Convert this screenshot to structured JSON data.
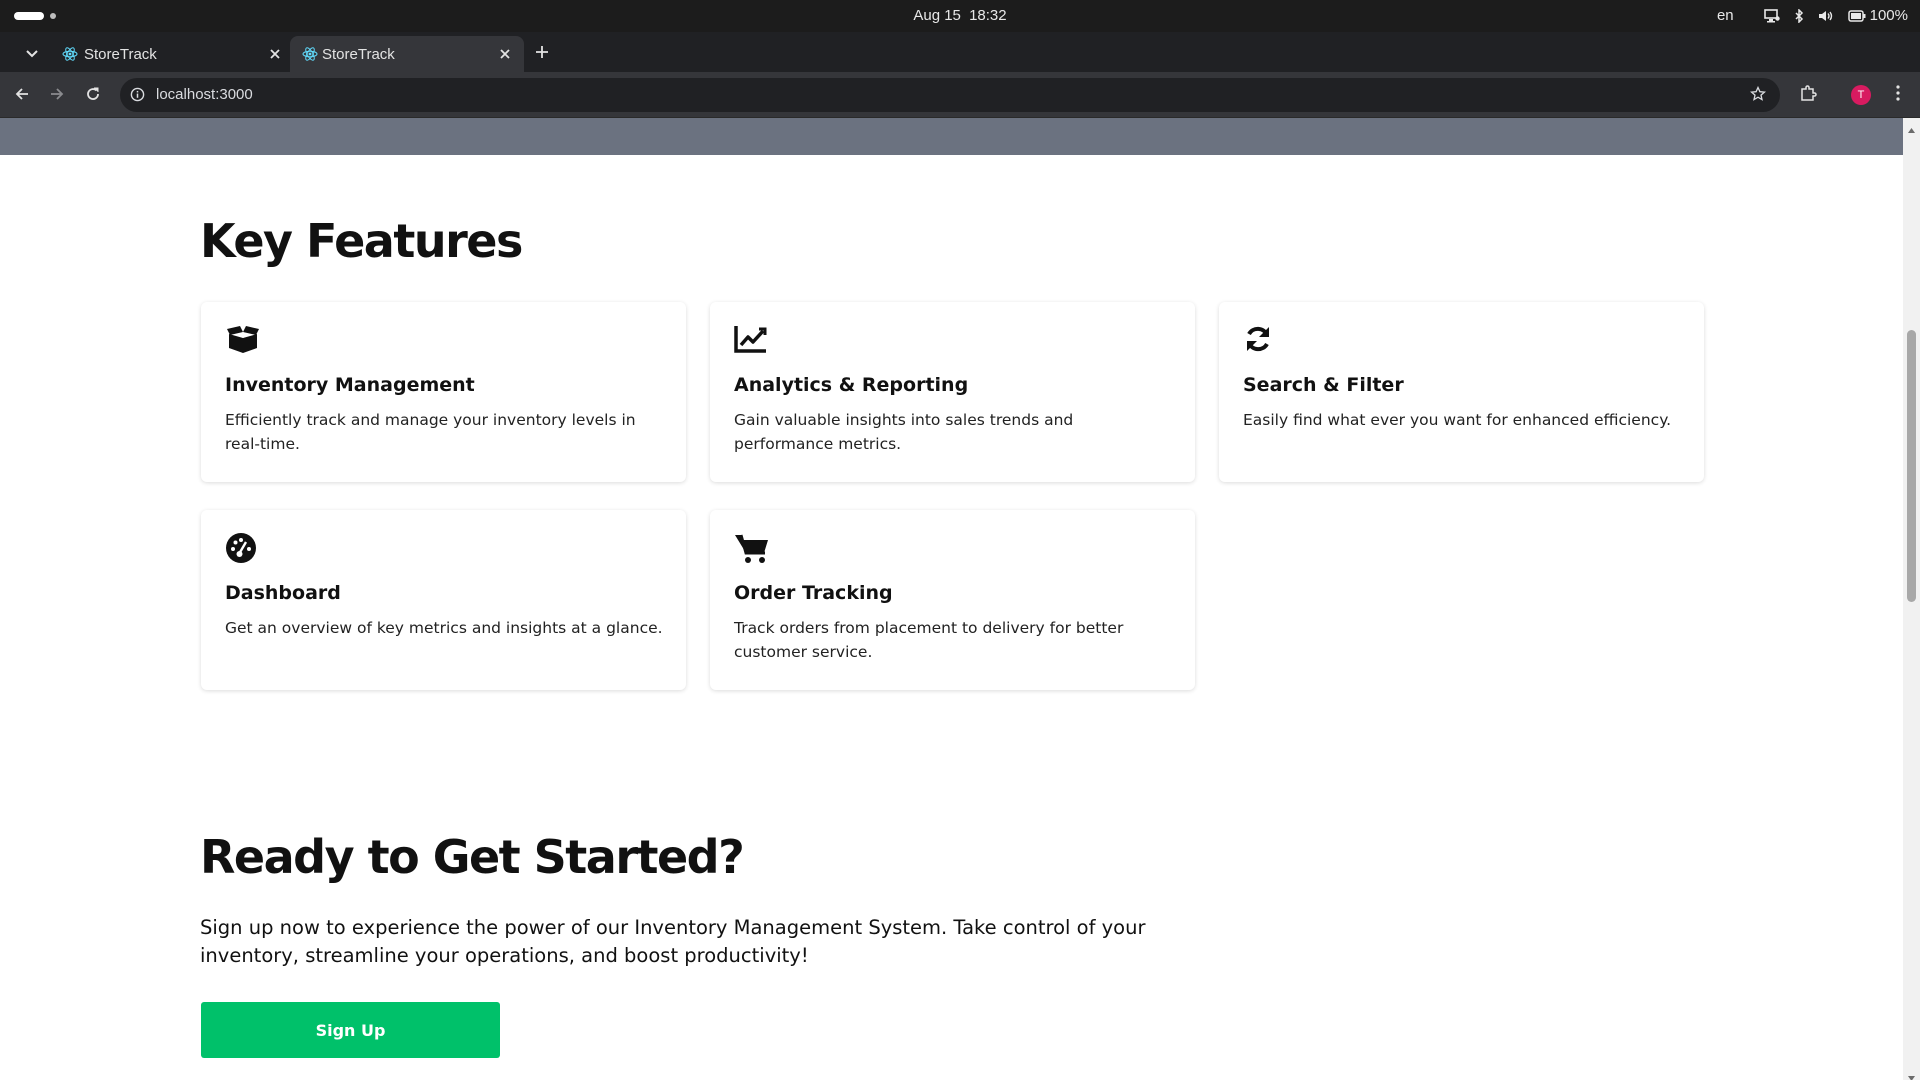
{
  "os": {
    "date": "Aug 15",
    "time": "18:32",
    "language": "en",
    "battery": "100%",
    "icons": [
      "display-icon",
      "bluetooth-icon",
      "volume-icon",
      "battery-icon"
    ]
  },
  "browser": {
    "tabs": [
      {
        "title": "StoreTrack",
        "active": false,
        "icon": "react-favicon"
      },
      {
        "title": "StoreTrack",
        "active": true,
        "icon": "react-favicon"
      }
    ],
    "url": "localhost:3000",
    "profile_initial": "T",
    "profile_color": "#d81b60"
  },
  "page": {
    "hero_strip_color": "#6b7280",
    "features": {
      "title": "Key Features",
      "items": [
        {
          "icon": "box-open-icon",
          "title": "Inventory Management",
          "description": "Efficiently track and manage your inventory levels in real-time."
        },
        {
          "icon": "line-chart-icon",
          "title": "Analytics & Reporting",
          "description": "Gain valuable insights into sales trends and performance metrics."
        },
        {
          "icon": "sync-icon",
          "title": "Search & Filter",
          "description": "Easily find what ever you want for enhanced efficiency."
        },
        {
          "icon": "dashboard-gauge-icon",
          "title": "Dashboard",
          "description": "Get an overview of key metrics and insights at a glance."
        },
        {
          "icon": "shopping-cart-icon",
          "title": "Order Tracking",
          "description": "Track orders from placement to delivery for better customer service."
        }
      ]
    },
    "cta": {
      "title": "Ready to Get Started?",
      "text": "Sign up now to experience the power of our Inventory Management System. Take control of your inventory, streamline your operations, and boost productivity!",
      "button_label": "Sign Up",
      "button_color": "#00c16a"
    }
  }
}
